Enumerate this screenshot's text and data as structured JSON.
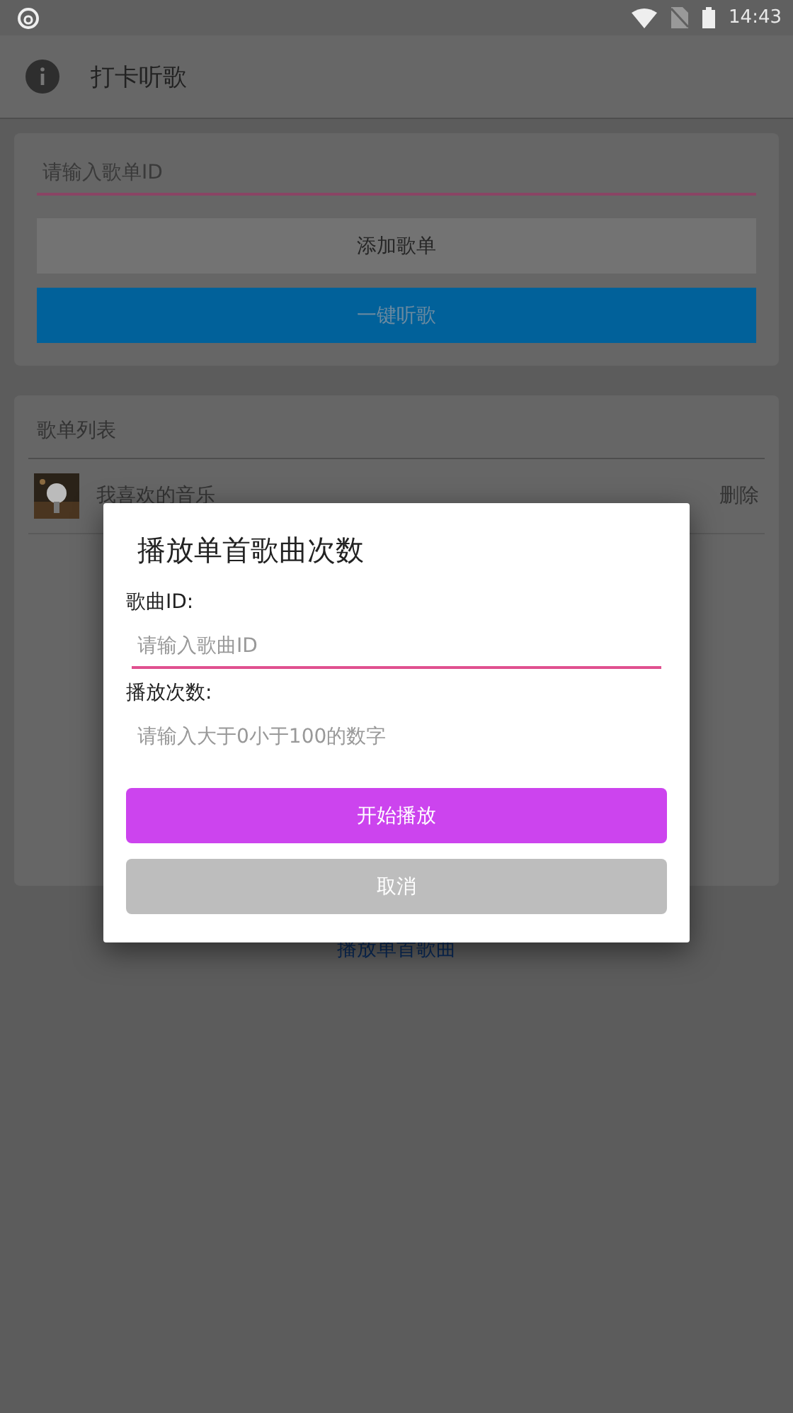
{
  "status_bar": {
    "time": "14:43"
  },
  "app_bar": {
    "title": "打卡听歌"
  },
  "playlist_form": {
    "placeholder": "请输入歌单ID",
    "buttons": [
      {
        "label": "添加歌单",
        "kind": "secondary"
      },
      {
        "label": "一键听歌",
        "kind": "primary"
      }
    ]
  },
  "playlists": {
    "title": "歌单列表",
    "items": [
      {
        "name": "我喜欢的音乐",
        "action": "删除"
      }
    ]
  },
  "link": "播放单首歌曲",
  "dialog": {
    "title": "播放单首歌曲次数",
    "fields": [
      {
        "label": "歌曲ID:",
        "placeholder": "请输入歌曲ID",
        "focused": true
      },
      {
        "label": "播放次数:",
        "placeholder": "请输入大于0小于100的数字",
        "focused": false
      }
    ],
    "buttons": [
      {
        "label": "开始播放",
        "kind": "primary"
      },
      {
        "label": "取消",
        "kind": "secondary"
      }
    ]
  }
}
